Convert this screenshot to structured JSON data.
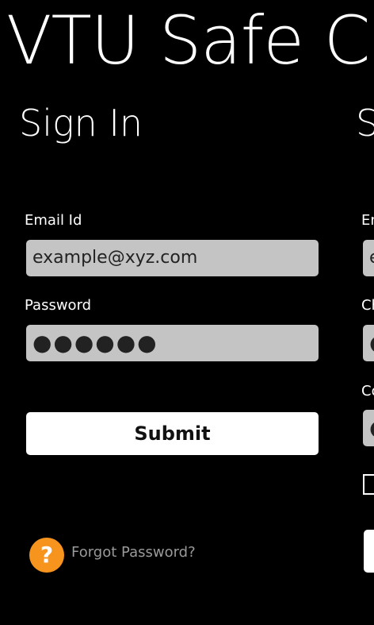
{
  "app": {
    "title": "VTU Safe Cam"
  },
  "signin": {
    "title": "Sign In",
    "email_label": "Email Id",
    "email_value": "example@xyz.com",
    "password_label": "Password",
    "password_value": "●●●●●●",
    "submit_label": "Submit",
    "help_icon_glyph": "?",
    "forgot_label": "Forgot Password?"
  },
  "signup": {
    "title": "S",
    "email_label": "En",
    "email_value": "e",
    "choose_password_label": "Ch",
    "choose_password_value": "●",
    "confirm_password_label": "Co",
    "confirm_password_value": "●"
  },
  "colors": {
    "background": "#000000",
    "input_fill": "#c4c4c4",
    "help_icon": "#f7941d",
    "link_text": "#9a9a9a"
  }
}
